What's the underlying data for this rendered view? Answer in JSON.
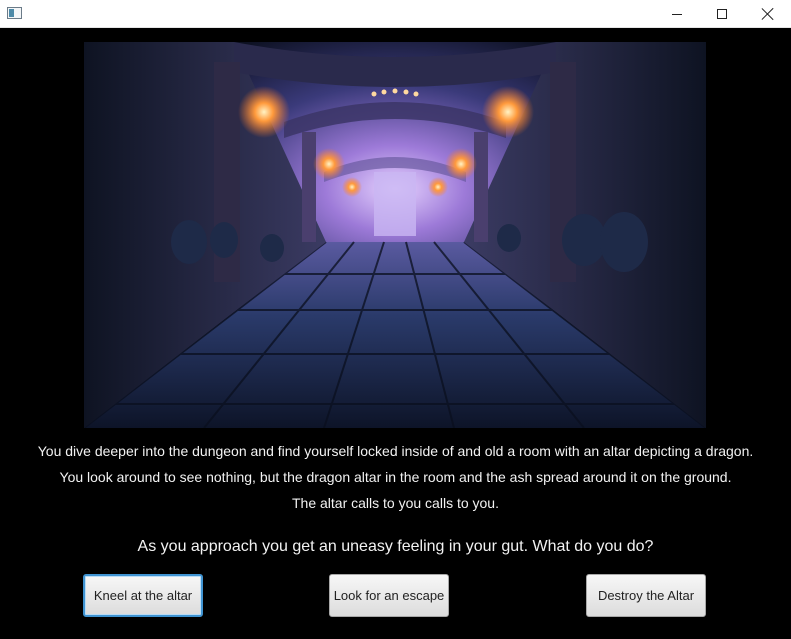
{
  "window": {
    "app_icon": "window-app-icon",
    "controls": [
      "minimize-icon",
      "maximize-icon",
      "close-icon"
    ]
  },
  "scene": {
    "image": "dungeon-corridor-illustration",
    "colors": {
      "stone": "#1d2d55",
      "torch": "#ff9a3c",
      "glow": "#d7c0ff"
    }
  },
  "story": {
    "lines": [
      "You dive deeper into the dungeon and find yourself locked inside of and old a room with an altar depicting a dragon.",
      "You look around to see nothing, but the dragon altar in the room and the ash spread around it on the ground.",
      "The altar calls to you calls to you."
    ]
  },
  "prompt": "As you approach you get an uneasy feeling in your gut. What do you do?",
  "choices": [
    {
      "label": "Kneel at the altar"
    },
    {
      "label": "Look for an escape"
    },
    {
      "label": "Destroy the Altar"
    }
  ],
  "colors": {
    "background": "#000000",
    "text": "#f2f2f2",
    "focus_border": "#3f93d1"
  }
}
